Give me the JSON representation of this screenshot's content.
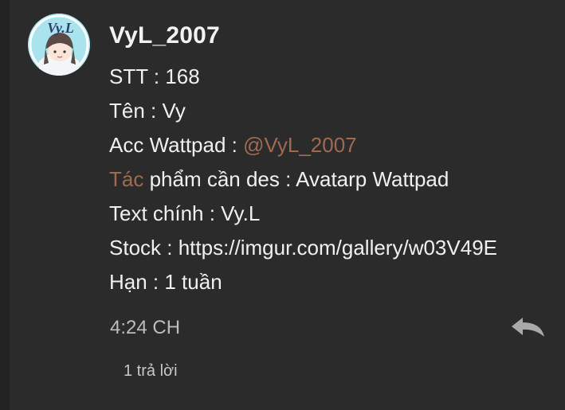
{
  "comment": {
    "username": "VyL_2007",
    "avatar_text": "Vy.L",
    "fields": [
      {
        "prefix": "STT : 168",
        "accent": "",
        "suffix": ""
      },
      {
        "prefix": "Tên : Vy",
        "accent": "",
        "suffix": ""
      },
      {
        "prefix": "Acc Wattpad : ",
        "accent": "@VyL_2007",
        "suffix": ""
      },
      {
        "prefix": "",
        "accent": "Tác",
        "suffix": " phẩm cần des : Avatarp Wattpad"
      },
      {
        "prefix": "Text chính : Vy.L",
        "accent": "",
        "suffix": ""
      },
      {
        "prefix": "Stock : https://imgur.com/gallery/w03V49E",
        "accent": "",
        "suffix": ""
      },
      {
        "prefix": "Hạn : 1 tuần",
        "accent": "",
        "suffix": ""
      }
    ],
    "timestamp": "4:24 CH",
    "replies_label": "1 trả lời",
    "reply_icon": "reply-arrow-icon"
  },
  "colors": {
    "background": "#2b2b2b",
    "text": "#f0f0f0",
    "mention_accent": "#a06a52",
    "muted": "#bdbdbd"
  }
}
